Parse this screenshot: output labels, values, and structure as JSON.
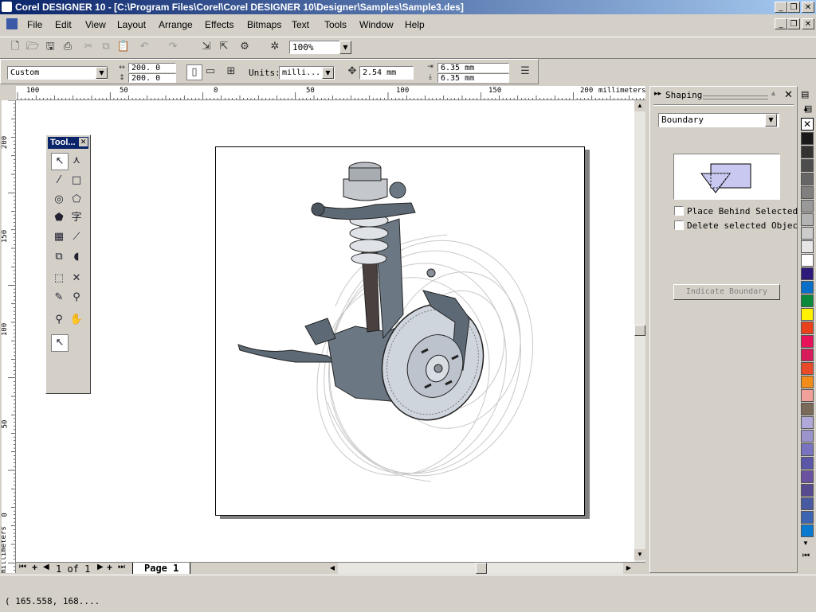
{
  "window": {
    "title": "Corel DESIGNER 10 - [C:\\Program Files\\Corel\\Corel DESIGNER 10\\Designer\\Samples\\Sample3.des]"
  },
  "menu": [
    "File",
    "Edit",
    "View",
    "Layout",
    "Arrange",
    "Effects",
    "Bitmaps",
    "Text",
    "Tools",
    "Window",
    "Help"
  ],
  "standard_toolbar": {
    "zoom": "100%"
  },
  "property_bar": {
    "paper_type": "Custom",
    "width": "200. 0",
    "height": "200. 0",
    "units_label": "Units:",
    "units_value": "milli...",
    "nudge": "2.54 mm",
    "dup_x": "6.35 mm",
    "dup_y": "6.35 mm"
  },
  "ruler": {
    "h_labels": [
      "100",
      "50",
      "0",
      "50",
      "100",
      "150",
      "200"
    ],
    "h_unit": "millimeters",
    "v_labels": [
      "200",
      "150",
      "100",
      "50",
      "0"
    ],
    "v_unit": "millimeters"
  },
  "toolbox": {
    "title": "Tool...",
    "tools": [
      "pick-tool-icon",
      "shape-tool-icon",
      "freehand-tool-icon",
      "rectangle-tool-icon",
      "ellipse-tool-icon",
      "polygon-tool-icon",
      "basic-shapes-icon",
      "text-tool-icon",
      "graph-paper-icon",
      "dimension-tool-icon",
      "interactive-fill-icon",
      "blend-tool-icon",
      "extrude-tool-icon",
      "knife-tool-icon",
      "outline-tool-icon",
      "eyedropper-icon",
      "zoom-tool-icon",
      "pan-tool-icon",
      "pointer-icon"
    ]
  },
  "page_nav": {
    "counter": "1 of 1",
    "tab": "Page 1"
  },
  "docker": {
    "title": "Shaping",
    "mode": "Boundary",
    "option1": "Place Behind Selected",
    "option2": "Delete selected Objec",
    "button": "Indicate Boundary"
  },
  "palette": [
    "#1a1a1a",
    "#333333",
    "#4d4d4d",
    "#666666",
    "#808080",
    "#999999",
    "#b3b3b3",
    "#cccccc",
    "#e6e6e6",
    "#ffffff",
    "#2e1a7a",
    "#0a6fc8",
    "#0c8a3c",
    "#fff200",
    "#e8411c",
    "#e8125a",
    "#d81b5a",
    "#e84a2a",
    "#f28c1a",
    "#f2a09a",
    "#7a6a5a",
    "#b0a8d8",
    "#9c94cc",
    "#7a74c0",
    "#5c56a8",
    "#6a52a0",
    "#584a90",
    "#4a5aa0",
    "#3c64b0",
    "#0a7ad0"
  ],
  "status": {
    "coords": "( 165.558, 168...."
  }
}
